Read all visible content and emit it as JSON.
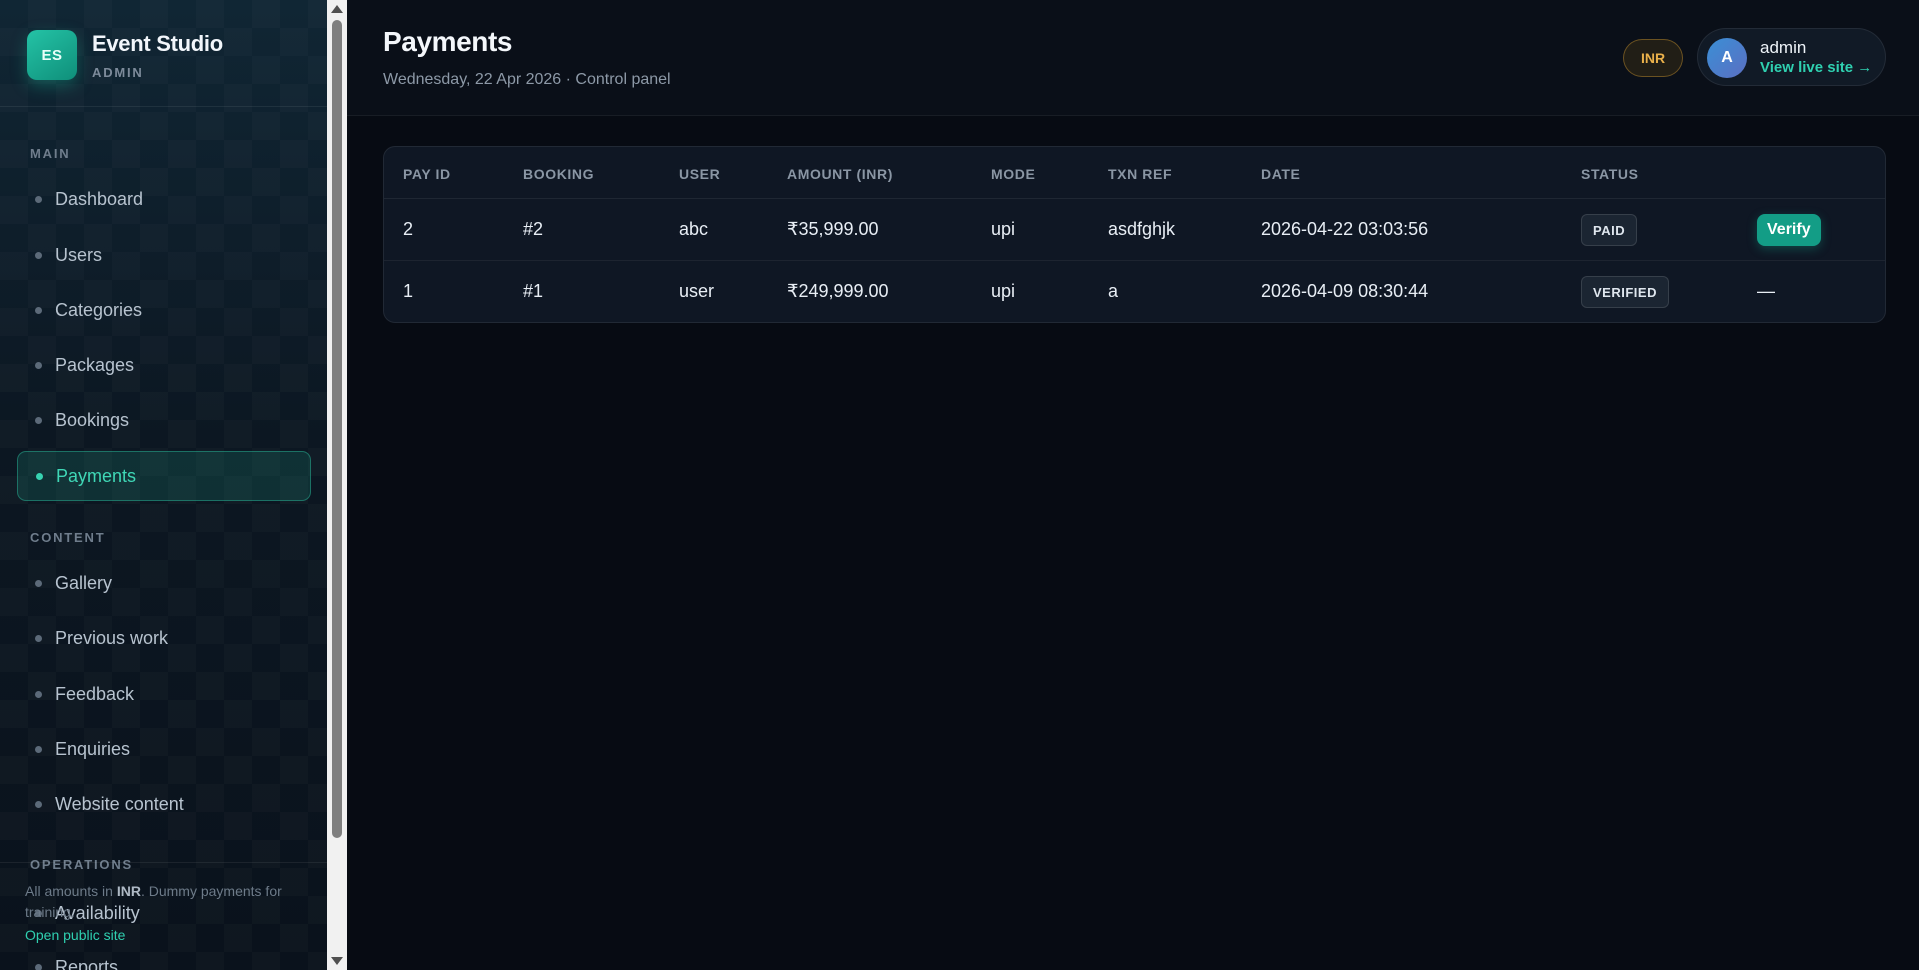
{
  "brand": {
    "logo_text": "ES",
    "name": "Event Studio",
    "subtitle": "ADMIN"
  },
  "sidebar": {
    "sections": [
      {
        "title": "MAIN"
      },
      {
        "title": "CONTENT"
      },
      {
        "title": "OPERATIONS"
      }
    ],
    "items": [
      {
        "label": "Dashboard"
      },
      {
        "label": "Users"
      },
      {
        "label": "Categories"
      },
      {
        "label": "Packages"
      },
      {
        "label": "Bookings"
      },
      {
        "label": "Payments",
        "active": true
      },
      {
        "label": "Gallery"
      },
      {
        "label": "Previous work"
      },
      {
        "label": "Feedback"
      },
      {
        "label": "Enquiries"
      },
      {
        "label": "Website content"
      },
      {
        "label": "Availability"
      },
      {
        "label": "Reports"
      }
    ],
    "footer": {
      "note_prefix": "All amounts in ",
      "note_currency": "INR",
      "note_suffix": ". Dummy payments for training.",
      "link": "Open public site"
    }
  },
  "header": {
    "title": "Payments",
    "subtitle": "Wednesday, 22 Apr 2026 · Control panel",
    "currency_badge": "INR",
    "user": {
      "avatar_letter": "A",
      "name": "admin",
      "link": "View live site →"
    }
  },
  "table": {
    "columns": [
      "PAY ID",
      "BOOKING",
      "USER",
      "AMOUNT (INR)",
      "MODE",
      "TXN REF",
      "DATE",
      "STATUS",
      ""
    ],
    "rows": [
      {
        "pay_id": "2",
        "booking": "#2",
        "user": "abc",
        "amount": "₹35,999.00",
        "mode": "upi",
        "txn_ref": "asdfghjk",
        "date": "2026-04-22 03:03:56",
        "status": "PAID",
        "action": "Verify"
      },
      {
        "pay_id": "1",
        "booking": "#1",
        "user": "user",
        "amount": "₹249,999.00",
        "mode": "upi",
        "txn_ref": "a",
        "date": "2026-04-09 08:30:44",
        "status": "VERIFIED",
        "action": "—"
      }
    ]
  },
  "colors": {
    "accent": "#2fd0b0",
    "background": "#070b13",
    "sidebar": "#0d1824",
    "currency_badge": "#e9b04a"
  }
}
